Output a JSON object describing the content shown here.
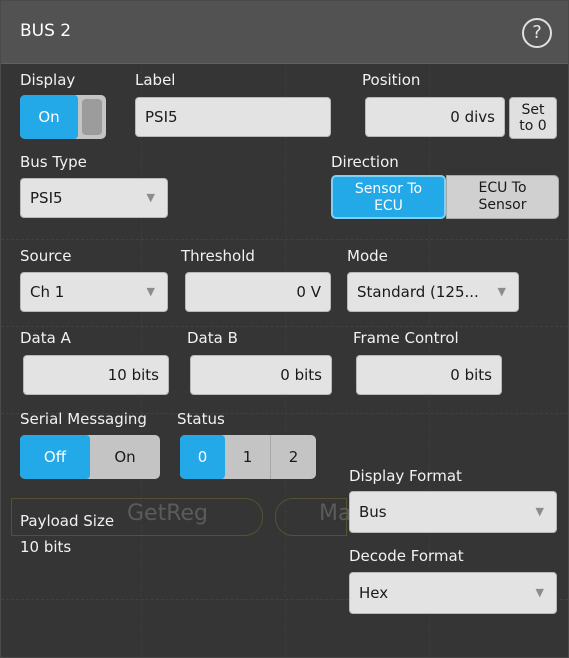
{
  "header": {
    "title": "BUS 2",
    "help_glyph": "?"
  },
  "display": {
    "label": "Display",
    "state": "On",
    "knob": ""
  },
  "label_field": {
    "label": "Label",
    "value": "PSI5"
  },
  "position": {
    "label": "Position",
    "value": "0 divs",
    "set_zero_line1": "Set",
    "set_zero_line2": "to 0"
  },
  "bus_type": {
    "label": "Bus Type",
    "value": "PSI5"
  },
  "direction": {
    "label": "Direction",
    "options": [
      {
        "line1": "Sensor To",
        "line2": "ECU",
        "selected": true
      },
      {
        "line1": "ECU To",
        "line2": "Sensor",
        "selected": false
      }
    ]
  },
  "source": {
    "label": "Source",
    "value": "Ch 1"
  },
  "threshold": {
    "label": "Threshold",
    "value": "0 V"
  },
  "mode": {
    "label": "Mode",
    "value": "Standard (125..."
  },
  "data_a": {
    "label": "Data A",
    "value": "10 bits"
  },
  "data_b": {
    "label": "Data B",
    "value": "0 bits"
  },
  "frame_control": {
    "label": "Frame Control",
    "value": "0 bits"
  },
  "serial_messaging": {
    "label": "Serial Messaging",
    "options": [
      "Off",
      "On"
    ],
    "selected": "Off"
  },
  "status": {
    "label": "Status",
    "options": [
      "0",
      "1",
      "2"
    ],
    "selected": "0"
  },
  "payload": {
    "label": "Payload Size",
    "value": "10 bits"
  },
  "display_format": {
    "label": "Display Format",
    "value": "Bus"
  },
  "decode_format": {
    "label": "Decode Format",
    "value": "Hex"
  },
  "background_decode": {
    "text1": "GetReg",
    "text2": "Ma"
  },
  "colors": {
    "accent": "#23a8e8",
    "panel": "#353535",
    "header": "#525252"
  },
  "icons": {
    "dropdown": "chevron-down-icon",
    "help": "help-circle-icon"
  }
}
